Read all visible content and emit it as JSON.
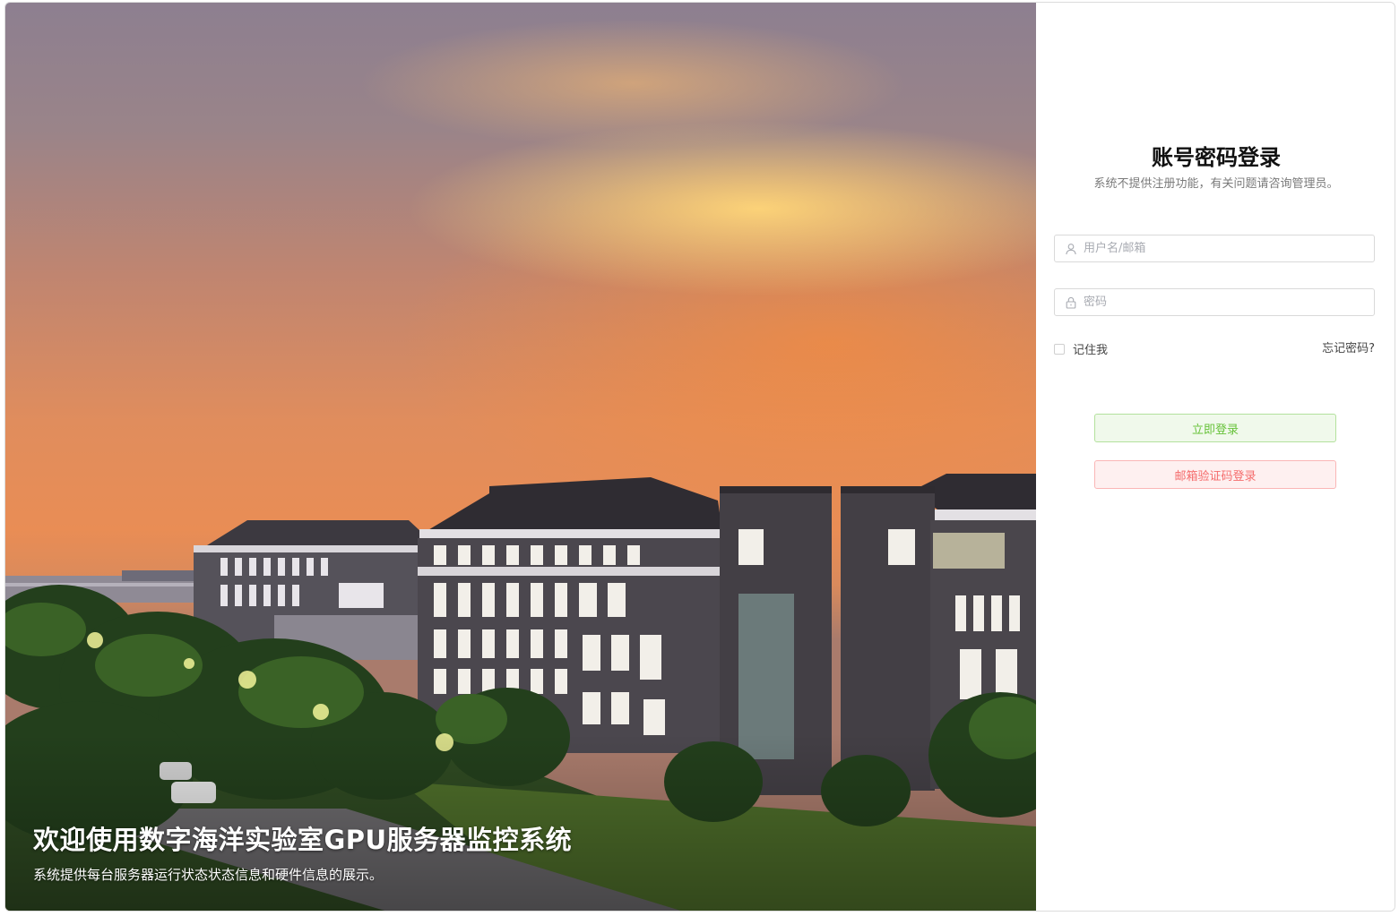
{
  "hero": {
    "title": "欢迎使用数字海洋实验室GPU服务器监控系统",
    "subtitle": "系统提供每台服务器运行状态状态信息和硬件信息的展示。",
    "image_description": "campus-buildings-sunset"
  },
  "login": {
    "title": "账号密码登录",
    "subtitle": "系统不提供注册功能，有关问题请咨询管理员。",
    "username": {
      "value": "",
      "placeholder": "用户名/邮箱",
      "icon": "user-icon"
    },
    "password": {
      "value": "",
      "placeholder": "密码",
      "icon": "lock-icon"
    },
    "remember_label": "记住我",
    "remember_checked": false,
    "forgot_label": "忘记密码?",
    "login_button": "立即登录",
    "email_login_button": "邮箱验证码登录"
  },
  "colors": {
    "success_bg": "#f0f9eb",
    "success_border": "#b3e19d",
    "success_text": "#67c23a",
    "danger_bg": "#fef0f0",
    "danger_border": "#fab6b6",
    "danger_text": "#f56c6c"
  }
}
